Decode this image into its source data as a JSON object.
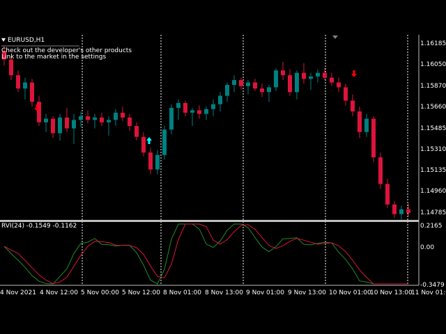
{
  "header": {
    "symbol": "EURUSD,H1",
    "notice_line1": "Check out the developer's other products",
    "notice_line2": "Link to the market in the settings"
  },
  "price_axis": [
    "1.16185",
    "1.16050",
    "1.15870",
    "1.15660",
    "1.15485",
    "1.15310",
    "1.15135",
    "1.14960",
    "1.14785"
  ],
  "indicator": {
    "label": "RVI(24) -0.1549 -0.1162",
    "axis": [
      "0.2165",
      "0.00",
      "-0.3479"
    ]
  },
  "time_axis": [
    "4 Nov 2021",
    "4 Nov 12:00",
    "5 Nov 00:00",
    "5 Nov 12:00",
    "8 Nov 01:00",
    "8 Nov 13:00",
    "9 Nov 01:00",
    "9 Nov 13:00",
    "10 Nov 01:00",
    "10 Nov 13:00",
    "11 Nov 01:00"
  ],
  "colors": {
    "bull": "#008080",
    "bear": "#dc143c",
    "buy_arrow": "#00ffff",
    "sell_arrow": "#ff0000",
    "rvi_main": "#228b22",
    "rvi_signal": "#dc143c",
    "separator": "#c0c0c0"
  },
  "chart_data": {
    "type": "candlestick",
    "series": [
      {
        "name": "EURUSD,H1",
        "ohlc": [
          [
            1.1612,
            1.1616,
            1.16,
            1.1605
          ],
          [
            1.1605,
            1.1608,
            1.1588,
            1.1592
          ],
          [
            1.1592,
            1.1596,
            1.1578,
            1.1581
          ],
          [
            1.1581,
            1.159,
            1.1572,
            1.1586
          ],
          [
            1.1586,
            1.1589,
            1.1566,
            1.157
          ],
          [
            1.157,
            1.1575,
            1.155,
            1.1553
          ],
          [
            1.1553,
            1.156,
            1.1545,
            1.1556
          ],
          [
            1.1556,
            1.1558,
            1.154,
            1.1544
          ],
          [
            1.1544,
            1.156,
            1.1538,
            1.1557
          ],
          [
            1.1557,
            1.1565,
            1.1545,
            1.1548
          ],
          [
            1.1548,
            1.156,
            1.1535,
            1.1555
          ],
          [
            1.1555,
            1.1562,
            1.1549,
            1.1558
          ],
          [
            1.1558,
            1.1563,
            1.1552,
            1.1555
          ],
          [
            1.1555,
            1.156,
            1.1548,
            1.1557
          ],
          [
            1.1557,
            1.1561,
            1.155,
            1.1553
          ],
          [
            1.1553,
            1.1558,
            1.1542,
            1.1555
          ],
          [
            1.1555,
            1.1564,
            1.155,
            1.1561
          ],
          [
            1.1561,
            1.1566,
            1.1554,
            1.1557
          ],
          [
            1.1557,
            1.156,
            1.1546,
            1.155
          ],
          [
            1.155,
            1.1553,
            1.1538,
            1.1541
          ],
          [
            1.1541,
            1.1545,
            1.1525,
            1.1528
          ],
          [
            1.1528,
            1.1532,
            1.151,
            1.1514
          ],
          [
            1.1514,
            1.153,
            1.151,
            1.1526
          ],
          [
            1.1526,
            1.155,
            1.1522,
            1.1547
          ],
          [
            1.1547,
            1.1568,
            1.1543,
            1.1565
          ],
          [
            1.1565,
            1.1572,
            1.1555,
            1.1569
          ],
          [
            1.1569,
            1.1571,
            1.1558,
            1.1561
          ],
          [
            1.1561,
            1.1565,
            1.155,
            1.1563
          ],
          [
            1.1563,
            1.1567,
            1.1556,
            1.156
          ],
          [
            1.156,
            1.1566,
            1.1555,
            1.1564
          ],
          [
            1.1564,
            1.1572,
            1.1558,
            1.1568
          ],
          [
            1.1568,
            1.1578,
            1.1562,
            1.1575
          ],
          [
            1.1575,
            1.1586,
            1.157,
            1.1584
          ],
          [
            1.1584,
            1.1592,
            1.1578,
            1.1588
          ],
          [
            1.1588,
            1.159,
            1.158,
            1.1583
          ],
          [
            1.1583,
            1.1588,
            1.1576,
            1.1586
          ],
          [
            1.1586,
            1.1589,
            1.1579,
            1.1581
          ],
          [
            1.1581,
            1.1585,
            1.1574,
            1.1578
          ],
          [
            1.1578,
            1.1584,
            1.157,
            1.1582
          ],
          [
            1.1582,
            1.1598,
            1.1579,
            1.1596
          ],
          [
            1.1596,
            1.1603,
            1.1588,
            1.1592
          ],
          [
            1.1592,
            1.1597,
            1.1575,
            1.1578
          ],
          [
            1.1578,
            1.1596,
            1.1572,
            1.1594
          ],
          [
            1.1594,
            1.1602,
            1.1585,
            1.1589
          ],
          [
            1.1589,
            1.1594,
            1.158,
            1.1591
          ],
          [
            1.1591,
            1.1597,
            1.1586,
            1.1594
          ],
          [
            1.1594,
            1.1598,
            1.1588,
            1.159
          ],
          [
            1.159,
            1.1594,
            1.1583,
            1.1586
          ],
          [
            1.1586,
            1.159,
            1.1578,
            1.1582
          ],
          [
            1.1582,
            1.1585,
            1.1567,
            1.1571
          ],
          [
            1.1571,
            1.1576,
            1.1558,
            1.1562
          ],
          [
            1.1562,
            1.1566,
            1.154,
            1.1545
          ],
          [
            1.1545,
            1.156,
            1.1541,
            1.1556
          ],
          [
            1.1556,
            1.1558,
            1.152,
            1.1524
          ],
          [
            1.1524,
            1.1528,
            1.1498,
            1.1502
          ],
          [
            1.1502,
            1.1506,
            1.1482,
            1.1485
          ],
          [
            1.1485,
            1.1488,
            1.1474,
            1.1477
          ],
          [
            1.1477,
            1.1484,
            1.1472,
            1.1481
          ],
          [
            1.1481,
            1.1486,
            1.1475,
            1.1478
          ]
        ]
      }
    ]
  }
}
